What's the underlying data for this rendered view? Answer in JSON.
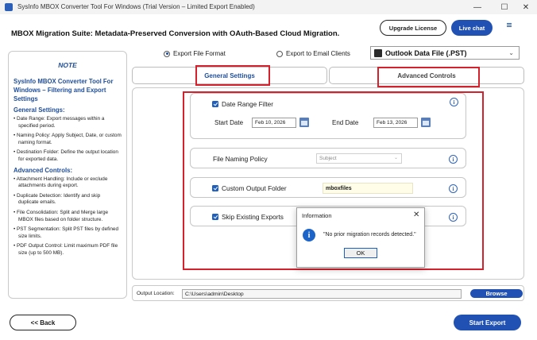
{
  "window": {
    "title": "SysInfo MBOX Converter Tool For Windows (Trial Version – Limited Export Enabled)",
    "minimize_glyph": "—",
    "maximize_glyph": "☐",
    "close_glyph": "✕"
  },
  "header": {
    "title": "MBOX Migration Suite: Metadata-Preserved Conversion with OAuth-Based Cloud Migration.",
    "upgrade_label": "Upgrade License",
    "live_chat_label": "Live chat",
    "menu_icon": "hamburger-icon"
  },
  "note": {
    "heading": "NOTE",
    "title": "SysInfo MBOX Converter Tool For Windows – Filtering and Export Settings",
    "general_heading": "General Settings:",
    "general_items": [
      "• Date Range: Export messages within a specified period.",
      "• Naming Policy: Apply Subject, Date, or custom naming format.",
      "• Destination Folder: Define the output location for exported data."
    ],
    "advanced_heading": "Advanced Controls:",
    "advanced_items": [
      "• Attachment Handling: Include or exclude attachments during export.",
      "• Duplicate Detection: Identify and skip duplicate emails.",
      "• File Consolidation: Split and Merge large MBOX files based on folder structure.",
      "• PST Segmentation: Split PST files by defined size limits.",
      "• PDF Output Control: Limit maximum PDF file size (up to 500 MB)."
    ]
  },
  "mode": {
    "export_file_label": "Export File Format",
    "export_email_label": "Export to Email Clients",
    "selected": "Export File Format"
  },
  "format_select": {
    "value": "Outlook Data File (.PST)",
    "chevron": "⌄"
  },
  "tabs": [
    {
      "label": "General Settings",
      "active": true
    },
    {
      "label": "Advanced Controls",
      "active": false
    }
  ],
  "settings": {
    "date_range": {
      "label": "Date Range Filter",
      "checked": true,
      "start_label": "Start Date",
      "start_value": "Feb 10, 2026",
      "end_label": "End Date",
      "end_value": "Feb 13, 2026"
    },
    "naming": {
      "label": "File Naming Policy",
      "value": "Subject"
    },
    "output_folder": {
      "label": "Custom Output Folder",
      "checked": true,
      "value": "mboxfiles"
    },
    "skip_existing": {
      "label": "Skip Existing Exports",
      "checked": true
    },
    "info_glyph": "i"
  },
  "dialog": {
    "title": "Information",
    "close_glyph": "✕",
    "icon_glyph": "i",
    "message": "\"No prior migration records detected.\"",
    "ok_label": "OK"
  },
  "output": {
    "label": "Output Location:",
    "path": "C:\\Users\\admin\\Desktop",
    "browse_label": "Browse"
  },
  "footer": {
    "back_label": "<<  Back",
    "start_label": "Start Export"
  },
  "colors": {
    "accent": "#2152b3",
    "highlight_red": "#d3212d",
    "link_blue": "#1f4e9a"
  }
}
